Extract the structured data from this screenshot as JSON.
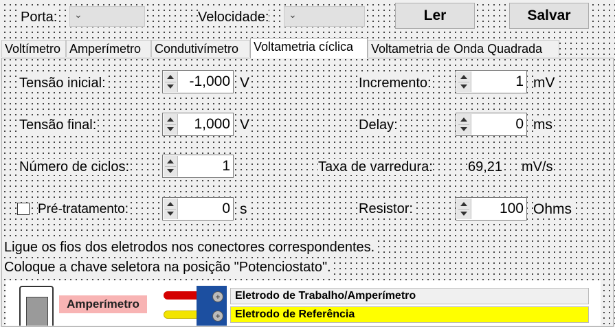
{
  "header": {
    "porta_label": "Porta:",
    "porta_value": "",
    "velocidade_label": "Velocidade:",
    "velocidade_value": "",
    "ler_button": "Ler",
    "salvar_button": "Salvar"
  },
  "tabs": [
    "Voltímetro",
    "Amperímetro",
    "Condutivímetro",
    "Voltametria cíclica",
    "Voltametria de Onda Quadrada"
  ],
  "active_tab": "Voltametria cíclica",
  "form": {
    "tensao_inicial": {
      "label": "Tensão inicial:",
      "value": "-1,000",
      "unit": "V"
    },
    "tensao_final": {
      "label": "Tensão final:",
      "value": "1,000",
      "unit": "V"
    },
    "numero_ciclos": {
      "label": "Número de ciclos:",
      "value": "1"
    },
    "pre_tratamento": {
      "label": "Pré-tratamento:",
      "value": "0",
      "unit": "s",
      "checked": false
    },
    "incremento": {
      "label": "Incremento:",
      "value": "1",
      "unit": "mV"
    },
    "delay": {
      "label": "Delay:",
      "value": "0",
      "unit": "ms"
    },
    "taxa": {
      "label": "Taxa de varredura:",
      "value": "69,21",
      "unit": "mV/s"
    },
    "resistor": {
      "label": "Resistor:",
      "value": "100",
      "unit": "Ohms"
    }
  },
  "instructions": [
    "Ligue os fios dos eletrodos nos conectores correspondentes.",
    "Coloque a chave seletora na posição \"Potenciostato\"."
  ],
  "diagram": {
    "amperimetro_label": "Amperímetro",
    "eletrodo_trabalho": "Eletrodo de Trabalho/Amperímetro",
    "eletrodo_referencia": "Eletrodo de Referência",
    "colors": {
      "pink": "#f8b4b4",
      "highlight": "#ffff00",
      "blue": "#1c4fa0",
      "red_wire": "#d40000",
      "yellow_wire": "#f2e400"
    }
  }
}
